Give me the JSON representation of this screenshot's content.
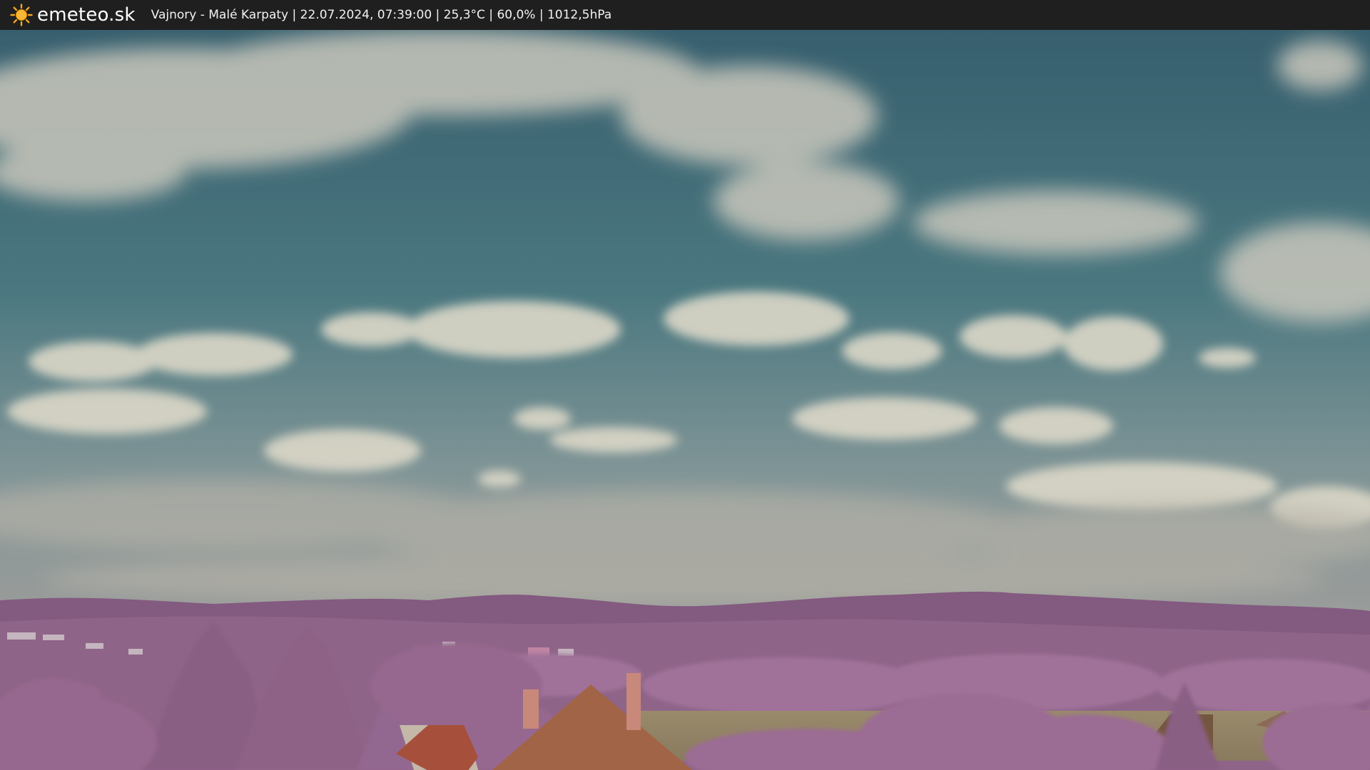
{
  "header": {
    "logo_text": "emeteo.sk",
    "logo_icon": "sun-icon",
    "caption": "Vajnory - Malé Karpaty | 22.07.2024, 07:39:00 | 25,3°C | 60,0% | 1012,5hPa"
  },
  "colors": {
    "bar": "#1f1f1f",
    "sun": "#f5a623",
    "sky_top": "#3a6674",
    "sky_bottom": "#8fa0a4",
    "hills": "#8a5e86",
    "foliage": "#9d6f97",
    "roof": "#a05a3c"
  }
}
